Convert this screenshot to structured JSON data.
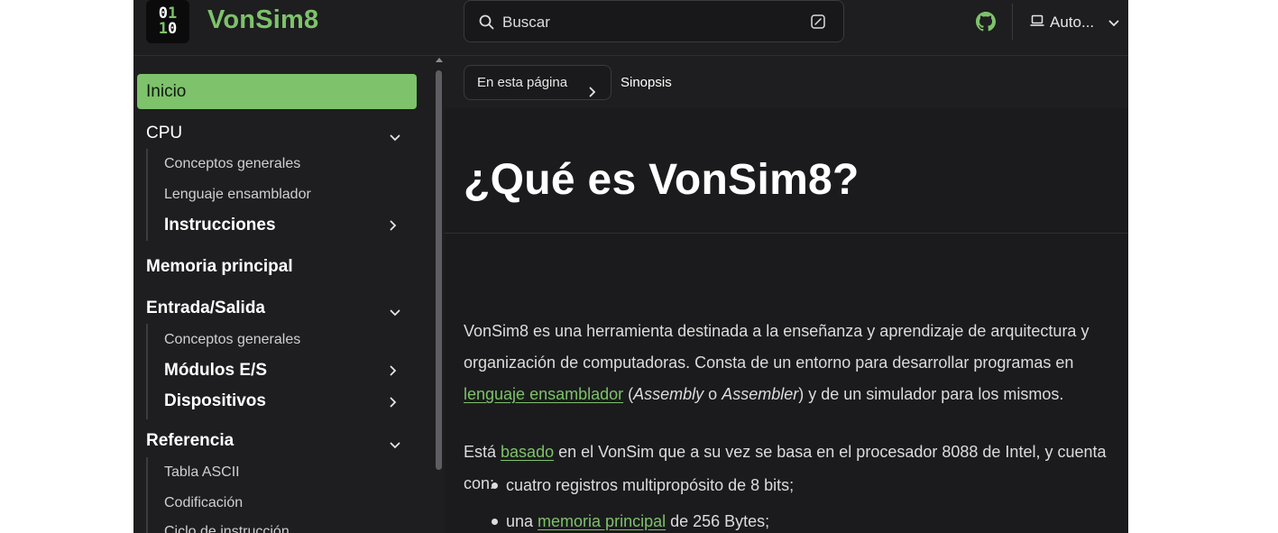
{
  "header": {
    "logo_top": [
      "0",
      "1"
    ],
    "logo_bottom": [
      "1",
      "0"
    ],
    "site_title": "VonSim8",
    "search_label": "Buscar",
    "theme_label": "Auto..."
  },
  "sidebar": {
    "active": "Inicio",
    "sections": {
      "cpu": "CPU",
      "cpu_items": [
        "Conceptos generales",
        "Lenguaje ensamblador",
        "Instrucciones"
      ],
      "memoria": "Memoria principal",
      "es": "Entrada/Salida",
      "es_items": [
        "Conceptos generales",
        "Módulos E/S",
        "Dispositivos"
      ],
      "ref": "Referencia",
      "ref_items": [
        "Tabla ASCII",
        "Codificación",
        "Ciclo de instrucción"
      ]
    }
  },
  "toc": {
    "button_label": "En esta página",
    "current": "Sinopsis"
  },
  "content": {
    "title": "¿Qué es VonSim8?",
    "p1_line1": "VonSim8 es una herramienta destinada a la enseñanza y aprendizaje de arquitectura y",
    "p1_line2": "organización de computadoras. Consta de un entorno para desarrollar programas en",
    "p1_link": "lenguaje ensamblador",
    "p1_open": " (",
    "p1_italic1": "Assembly",
    "p1_o": " o ",
    "p1_italic2": "Assembler",
    "p1_tail": ") y de un simulador para los mismos.",
    "p2_pre": "Está ",
    "p2_link": "basado",
    "p2_post": " en el VonSim que a su vez se basa en el procesador 8088 de Intel, y cuenta",
    "p2_line2": "con:",
    "bullet1": "cuatro registros multipropósito de 8 bits;",
    "bullet2_pre": "una ",
    "bullet2_link": "memoria principal",
    "bullet2_post": " de 256 Bytes;"
  },
  "colors": {
    "accent": "#7ec26b",
    "background": "#1e1e20"
  },
  "icons": [
    "search-icon",
    "keyboard-shortcut-icon",
    "github-icon",
    "laptop-icon",
    "chevron-down-icon",
    "chevron-right-icon"
  ]
}
